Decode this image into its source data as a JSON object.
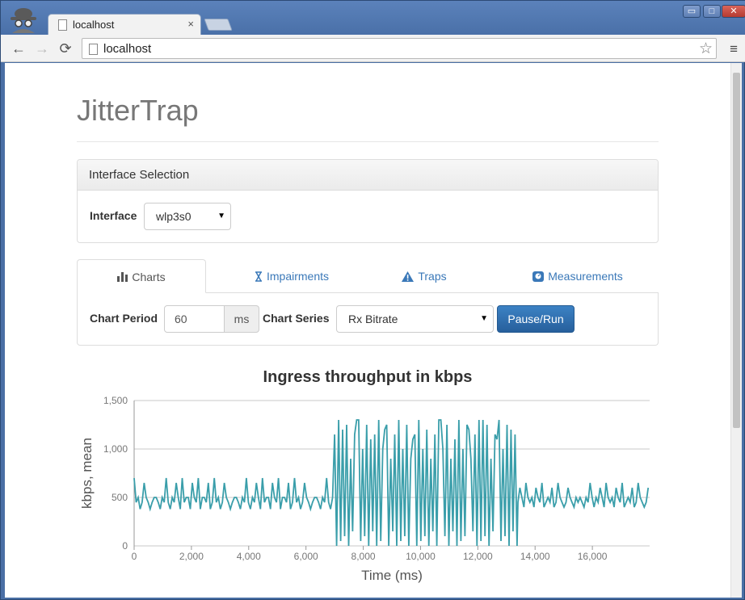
{
  "browser": {
    "tab_title": "localhost",
    "tab_close": "×",
    "url": "localhost",
    "back": "←",
    "forward": "→",
    "reload": "⟳",
    "star": "☆",
    "menu": "≡",
    "minimize": "▭",
    "maximize": "□",
    "close": "✕"
  },
  "page": {
    "title": "JitterTrap"
  },
  "interface_panel": {
    "heading": "Interface Selection",
    "label": "Interface",
    "selected": "wlp3s0"
  },
  "tabs": [
    {
      "label": "Charts",
      "icon": "bar-chart-icon",
      "active": true
    },
    {
      "label": "Impairments",
      "icon": "hourglass-icon",
      "active": false
    },
    {
      "label": "Traps",
      "icon": "warning-icon",
      "active": false
    },
    {
      "label": "Measurements",
      "icon": "gauge-icon",
      "active": false
    }
  ],
  "chart_controls": {
    "period_label": "Chart Period",
    "period_value": "60",
    "period_unit": "ms",
    "series_label": "Chart Series",
    "series_selected": "Rx Bitrate",
    "pause_run": "Pause/Run"
  },
  "chart_data": {
    "type": "line",
    "title": "Ingress throughput in kbps",
    "xlabel": "Time (ms)",
    "ylabel": "kbps, mean",
    "xlim": [
      0,
      18000
    ],
    "ylim": [
      0,
      1500
    ],
    "xticks": [
      "0",
      "2,000",
      "4,000",
      "6,000",
      "8,000",
      "10,000",
      "12,000",
      "14,000",
      "16,000"
    ],
    "yticks": [
      "0",
      "500",
      "1,000",
      "1,500"
    ],
    "grid": "horizontal",
    "color": "#3a9eaa",
    "period_ms": 60,
    "segments": [
      {
        "x_start": 0,
        "x_end": 7000,
        "pattern": [
          700,
          450,
          500,
          500,
          450,
          650,
          500,
          450
        ],
        "note_min": 380
      },
      {
        "x_start": 7000,
        "x_end": 13400,
        "pattern": [
          1150,
          0,
          1300,
          50,
          1000,
          100,
          1250,
          0,
          900,
          150
        ],
        "note_min": 0
      },
      {
        "x_start": 13400,
        "x_end": 18000,
        "pattern": [
          450,
          600,
          500,
          450,
          650,
          500,
          450,
          500
        ],
        "note_min": 400
      }
    ]
  }
}
